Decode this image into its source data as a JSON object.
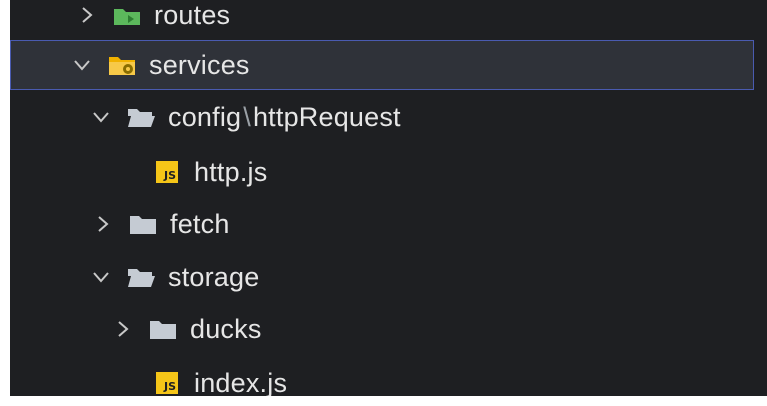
{
  "explorer": {
    "items": [
      {
        "label": "routes",
        "type": "folder",
        "expanded": false,
        "icon": "routes-folder-icon"
      },
      {
        "label": "services",
        "type": "folder",
        "expanded": true,
        "icon": "services-folder-icon",
        "selected": true
      },
      {
        "label": "config",
        "label_suffix": "httpRequest",
        "separator": "\\",
        "type": "folder",
        "expanded": true,
        "icon": "folder-open-icon"
      },
      {
        "label": "http.js",
        "type": "file",
        "icon": "js-file-icon",
        "badge": "JS"
      },
      {
        "label": "fetch",
        "type": "folder",
        "expanded": false,
        "icon": "folder-icon"
      },
      {
        "label": "storage",
        "type": "folder",
        "expanded": true,
        "icon": "folder-open-icon"
      },
      {
        "label": "ducks",
        "type": "folder",
        "expanded": false,
        "icon": "folder-icon"
      },
      {
        "label": "index.js",
        "type": "file",
        "icon": "js-file-icon",
        "badge": "JS"
      }
    ]
  },
  "colors": {
    "background": "#1e1f22",
    "selection": "#2f3239",
    "selection_border": "#4a5bb0",
    "folder": "#c5cbd3",
    "services_folder": "#f0b100",
    "routes_folder": "#5cb85c",
    "js_badge": "#f5c518"
  }
}
